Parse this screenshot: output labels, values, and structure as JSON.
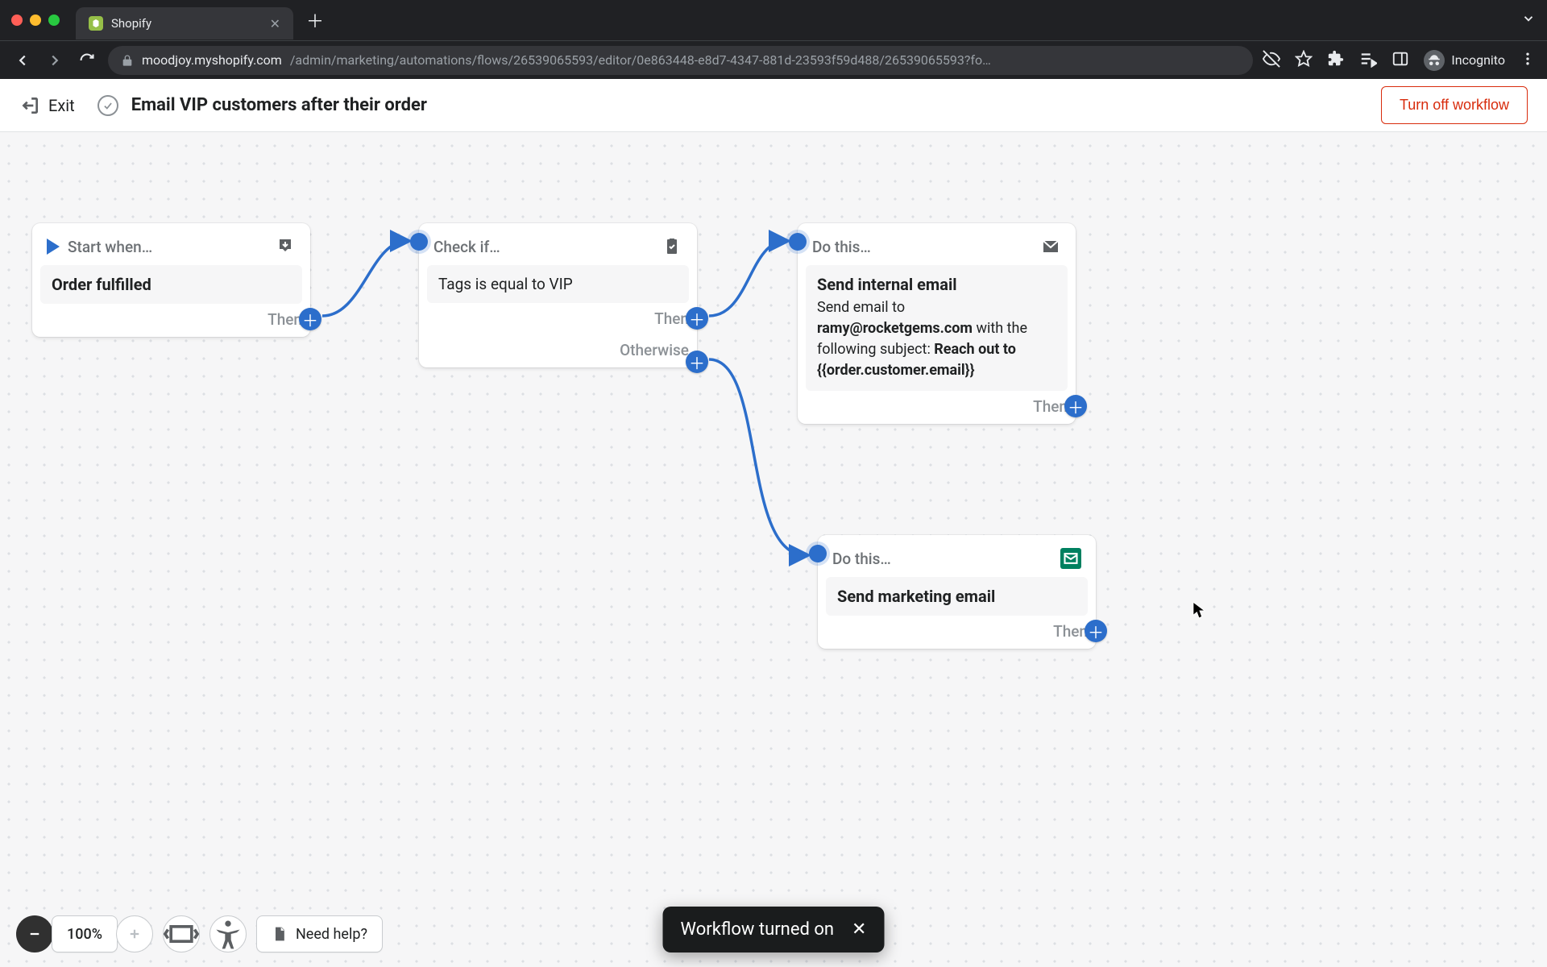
{
  "browser": {
    "tab_title": "Shopify",
    "url_host": "moodjoy.myshopify.com",
    "url_path": "/admin/marketing/automations/flows/26539065593/editor/0e863448-e8d7-4347-881d-23593f59d488/26539065593?fo…",
    "profile_label": "Incognito"
  },
  "header": {
    "exit_label": "Exit",
    "workflow_title": "Email VIP customers after their order",
    "turn_off_label": "Turn off workflow"
  },
  "nodes": {
    "start": {
      "head": "Start when…",
      "title": "Order fulfilled",
      "then": "Then"
    },
    "check": {
      "head": "Check if…",
      "condition": "Tags is equal to VIP",
      "then": "Then",
      "otherwise": "Otherwise"
    },
    "do1": {
      "head": "Do this…",
      "title": "Send internal email",
      "desc_1": "Send email to ",
      "email": "ramy@rocketgems.com",
      "desc_2": " with the following subject: ",
      "subject": "Reach out to {{order.customer.email}}",
      "then": "Then"
    },
    "do2": {
      "head": "Do this…",
      "title": "Send marketing email",
      "then": "Then"
    }
  },
  "zoom": {
    "level": "100%"
  },
  "help_label": "Need help?",
  "toast": {
    "message": "Workflow turned on"
  }
}
